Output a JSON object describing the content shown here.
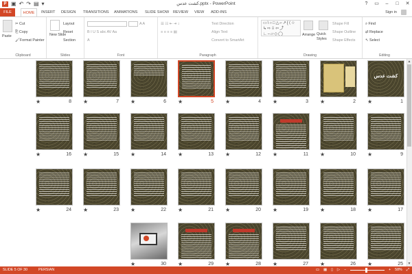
{
  "window": {
    "app_icon": "P",
    "title": "کشت عدس.pptx - PowerPoint",
    "qat_icons": [
      "save-icon",
      "undo-icon",
      "redo-icon",
      "start-slideshow-icon",
      "customize-qat-icon"
    ],
    "controls": [
      "?",
      "▭",
      "–",
      "□",
      "✕"
    ]
  },
  "tabs": [
    "FILE",
    "HOME",
    "INSERT",
    "DESIGN",
    "TRANSITIONS",
    "ANIMATIONS",
    "SLIDE SHOW",
    "REVIEW",
    "VIEW",
    "ADD-INS"
  ],
  "active_tab": "HOME",
  "signin_label": "Sign in",
  "ribbon": {
    "clipboard": {
      "label": "Clipboard",
      "paste": "Paste",
      "cut": "Cut",
      "copy": "Copy",
      "format_painter": "Format Painter"
    },
    "slides": {
      "label": "Slides",
      "new_slide": "New Slide",
      "layout": "Layout",
      "reset": "Reset",
      "section": "Section"
    },
    "font": {
      "label": "Font"
    },
    "paragraph": {
      "label": "Paragraph",
      "text_direction": "Text Direction",
      "align_text": "Align Text",
      "convert_smartart": "Convert to SmartArt"
    },
    "drawing": {
      "label": "Drawing",
      "shapes": "▭\\○□△⌐↗{⟨☆ ↳⇨⇩⇦⤴ ∟⎯▱◇◯",
      "arrange": "Arrange",
      "quick_styles": "Quick Styles",
      "shape_fill": "Shape Fill",
      "shape_outline": "Shape Outline",
      "shape_effects": "Shape Effects"
    },
    "editing": {
      "label": "Editing",
      "find": "Find",
      "replace": "Replace",
      "select": "Select"
    }
  },
  "slides": [
    {
      "n": "1",
      "kind": "title",
      "title": "کشت عدس"
    },
    {
      "n": "2",
      "kind": "image"
    },
    {
      "n": "3",
      "kind": "text"
    },
    {
      "n": "4",
      "kind": "text"
    },
    {
      "n": "5",
      "kind": "text",
      "selected": true
    },
    {
      "n": "6",
      "kind": "short"
    },
    {
      "n": "7",
      "kind": "text"
    },
    {
      "n": "8",
      "kind": "text"
    },
    {
      "n": "9",
      "kind": "text"
    },
    {
      "n": "10",
      "kind": "text"
    },
    {
      "n": "11",
      "kind": "heading"
    },
    {
      "n": "12",
      "kind": "text"
    },
    {
      "n": "13",
      "kind": "text"
    },
    {
      "n": "14",
      "kind": "text"
    },
    {
      "n": "15",
      "kind": "text"
    },
    {
      "n": "16",
      "kind": "text"
    },
    {
      "n": "17",
      "kind": "text"
    },
    {
      "n": "18",
      "kind": "text"
    },
    {
      "n": "19",
      "kind": "text"
    },
    {
      "n": "20",
      "kind": "text"
    },
    {
      "n": "21",
      "kind": "text"
    },
    {
      "n": "22",
      "kind": "text"
    },
    {
      "n": "23",
      "kind": "text"
    },
    {
      "n": "24",
      "kind": "text"
    },
    {
      "n": "25",
      "kind": "text"
    },
    {
      "n": "26",
      "kind": "text"
    },
    {
      "n": "27",
      "kind": "text"
    },
    {
      "n": "28",
      "kind": "heading"
    },
    {
      "n": "29",
      "kind": "heading"
    },
    {
      "n": "30",
      "kind": "laptop"
    }
  ],
  "star": "★",
  "status": {
    "slide_count": "SLIDE 5 OF 30",
    "language": "PERSIAN",
    "zoom": "58%",
    "minus": "−",
    "plus": "+",
    "colors": {
      "accent": "#d24726"
    }
  }
}
